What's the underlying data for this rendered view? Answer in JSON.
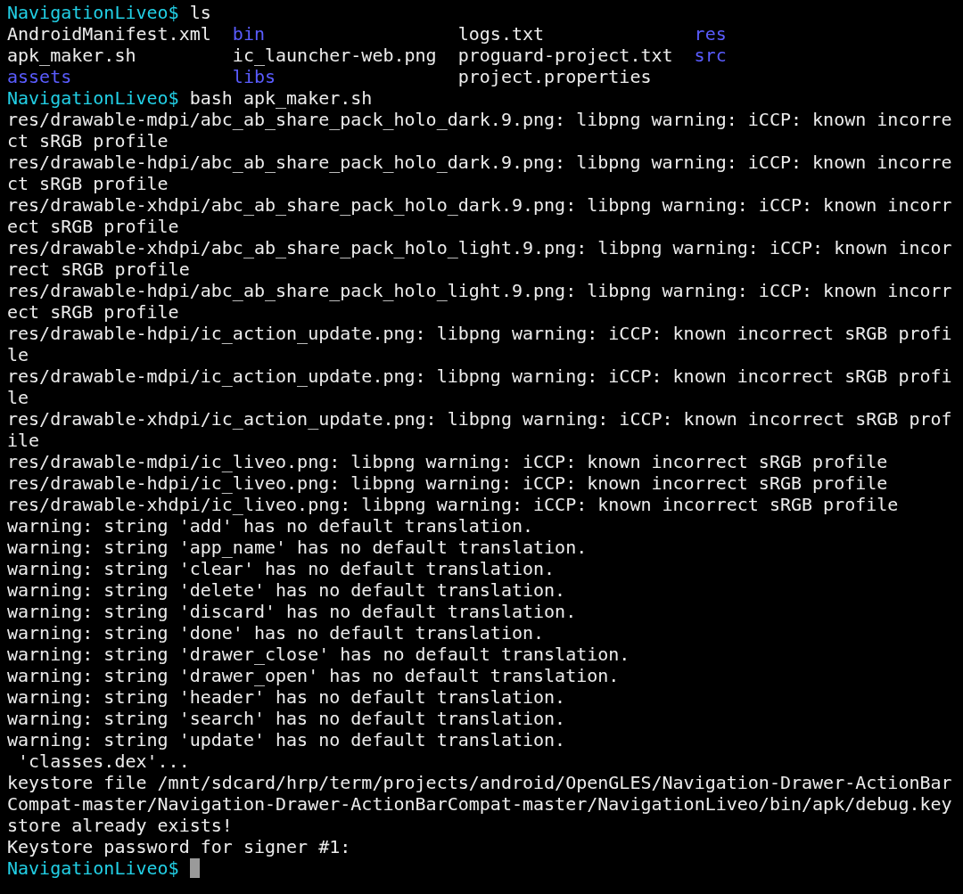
{
  "terminal": {
    "lines": [
      {
        "kind": "prompt",
        "prompt": "NavigationLiveo$",
        "command": "ls"
      },
      {
        "kind": "listing",
        "entries": [
          {
            "name": "AndroidManifest.xml",
            "kind": "file"
          },
          {
            "name": "bin",
            "kind": "dir"
          },
          {
            "name": "logs.txt",
            "kind": "file"
          },
          {
            "name": "res",
            "kind": "dir"
          }
        ]
      },
      {
        "kind": "listing",
        "entries": [
          {
            "name": "apk_maker.sh",
            "kind": "file"
          },
          {
            "name": "ic_launcher-web.png",
            "kind": "file"
          },
          {
            "name": "proguard-project.txt",
            "kind": "file"
          },
          {
            "name": "src",
            "kind": "dir"
          }
        ]
      },
      {
        "kind": "listing",
        "entries": [
          {
            "name": "assets",
            "kind": "dir"
          },
          {
            "name": "libs",
            "kind": "dir"
          },
          {
            "name": "project.properties",
            "kind": "file"
          }
        ]
      },
      {
        "kind": "prompt",
        "prompt": "NavigationLiveo$",
        "command": "bash apk_maker.sh"
      },
      {
        "kind": "output",
        "text": "res/drawable-mdpi/abc_ab_share_pack_holo_dark.9.png: libpng warning: iCCP: known incorre"
      },
      {
        "kind": "output",
        "text": "ct sRGB profile"
      },
      {
        "kind": "output",
        "text": "res/drawable-hdpi/abc_ab_share_pack_holo_dark.9.png: libpng warning: iCCP: known incorre"
      },
      {
        "kind": "output",
        "text": "ct sRGB profile"
      },
      {
        "kind": "output",
        "text": "res/drawable-xhdpi/abc_ab_share_pack_holo_dark.9.png: libpng warning: iCCP: known incorr"
      },
      {
        "kind": "output",
        "text": "ect sRGB profile"
      },
      {
        "kind": "output",
        "text": "res/drawable-xhdpi/abc_ab_share_pack_holo_light.9.png: libpng warning: iCCP: known incor"
      },
      {
        "kind": "output",
        "text": "rect sRGB profile"
      },
      {
        "kind": "output",
        "text": "res/drawable-hdpi/abc_ab_share_pack_holo_light.9.png: libpng warning: iCCP: known incorr"
      },
      {
        "kind": "output",
        "text": "ect sRGB profile"
      },
      {
        "kind": "output",
        "text": "res/drawable-hdpi/ic_action_update.png: libpng warning: iCCP: known incorrect sRGB profi"
      },
      {
        "kind": "output",
        "text": "le"
      },
      {
        "kind": "output",
        "text": "res/drawable-mdpi/ic_action_update.png: libpng warning: iCCP: known incorrect sRGB profi"
      },
      {
        "kind": "output",
        "text": "le"
      },
      {
        "kind": "output",
        "text": "res/drawable-xhdpi/ic_action_update.png: libpng warning: iCCP: known incorrect sRGB prof"
      },
      {
        "kind": "output",
        "text": "ile"
      },
      {
        "kind": "output",
        "text": "res/drawable-mdpi/ic_liveo.png: libpng warning: iCCP: known incorrect sRGB profile"
      },
      {
        "kind": "output",
        "text": "res/drawable-hdpi/ic_liveo.png: libpng warning: iCCP: known incorrect sRGB profile"
      },
      {
        "kind": "output",
        "text": "res/drawable-xhdpi/ic_liveo.png: libpng warning: iCCP: known incorrect sRGB profile"
      },
      {
        "kind": "output",
        "text": "warning: string 'add' has no default translation."
      },
      {
        "kind": "output",
        "text": "warning: string 'app_name' has no default translation."
      },
      {
        "kind": "output",
        "text": "warning: string 'clear' has no default translation."
      },
      {
        "kind": "output",
        "text": "warning: string 'delete' has no default translation."
      },
      {
        "kind": "output",
        "text": "warning: string 'discard' has no default translation."
      },
      {
        "kind": "output",
        "text": "warning: string 'done' has no default translation."
      },
      {
        "kind": "output",
        "text": "warning: string 'drawer_close' has no default translation."
      },
      {
        "kind": "output",
        "text": "warning: string 'drawer_open' has no default translation."
      },
      {
        "kind": "output",
        "text": "warning: string 'header' has no default translation."
      },
      {
        "kind": "output",
        "text": "warning: string 'search' has no default translation."
      },
      {
        "kind": "output",
        "text": "warning: string 'update' has no default translation."
      },
      {
        "kind": "output",
        "text": " 'classes.dex'..."
      },
      {
        "kind": "output",
        "text": "keystore file /mnt/sdcard/hrp/term/projects/android/OpenGLES/Navigation-Drawer-ActionBar"
      },
      {
        "kind": "output",
        "text": "Compat-master/Navigation-Drawer-ActionBarCompat-master/NavigationLiveo/bin/apk/debug.key"
      },
      {
        "kind": "output",
        "text": "store already exists!"
      },
      {
        "kind": "output",
        "text": "Keystore password for signer #1:"
      },
      {
        "kind": "prompt",
        "prompt": "NavigationLiveo$",
        "cursor": true
      }
    ]
  }
}
